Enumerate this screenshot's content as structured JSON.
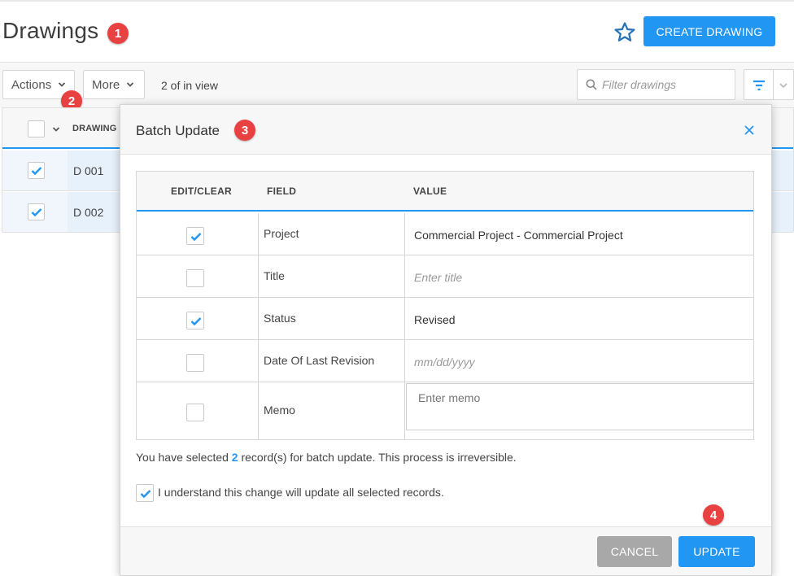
{
  "header": {
    "title": "Drawings",
    "favorite_icon": "star-outline-icon",
    "create_label": "CREATE DRAWING"
  },
  "toolbar": {
    "actions_label": "Actions",
    "more_label": "More",
    "view_count": "2 of in view",
    "filter_placeholder": "Filter drawings"
  },
  "grid": {
    "column_label": "DRAWING",
    "rows": [
      {
        "name": "D 001",
        "selected": true
      },
      {
        "name": "D 002",
        "selected": true
      }
    ]
  },
  "modal": {
    "title": "Batch Update",
    "columns": {
      "edit": "EDIT/CLEAR",
      "field": "FIELD",
      "value": "VALUE"
    },
    "rows": [
      {
        "field": "Project",
        "value": "Commercial Project - Commercial Project",
        "checked": true
      },
      {
        "field": "Title",
        "placeholder": "Enter title",
        "checked": false
      },
      {
        "field": "Status",
        "value": "Revised",
        "checked": true
      },
      {
        "field": "Date Of Last Revision",
        "placeholder": "mm/dd/yyyy",
        "checked": false
      },
      {
        "field": "Memo",
        "placeholder": "Enter memo",
        "checked": false
      }
    ],
    "message": {
      "prefix": "You have selected ",
      "count": "2",
      "suffix": " record(s) for batch update. This process is irreversible."
    },
    "acknowledge": {
      "label": "I understand this change will update all selected records.",
      "checked": true
    },
    "cancel_label": "CANCEL",
    "update_label": "UPDATE"
  },
  "callouts": [
    "1",
    "2",
    "3",
    "4"
  ],
  "colors": {
    "accent": "#2196f3",
    "callout": "#e84141",
    "cancel": "#a8a8a8"
  }
}
